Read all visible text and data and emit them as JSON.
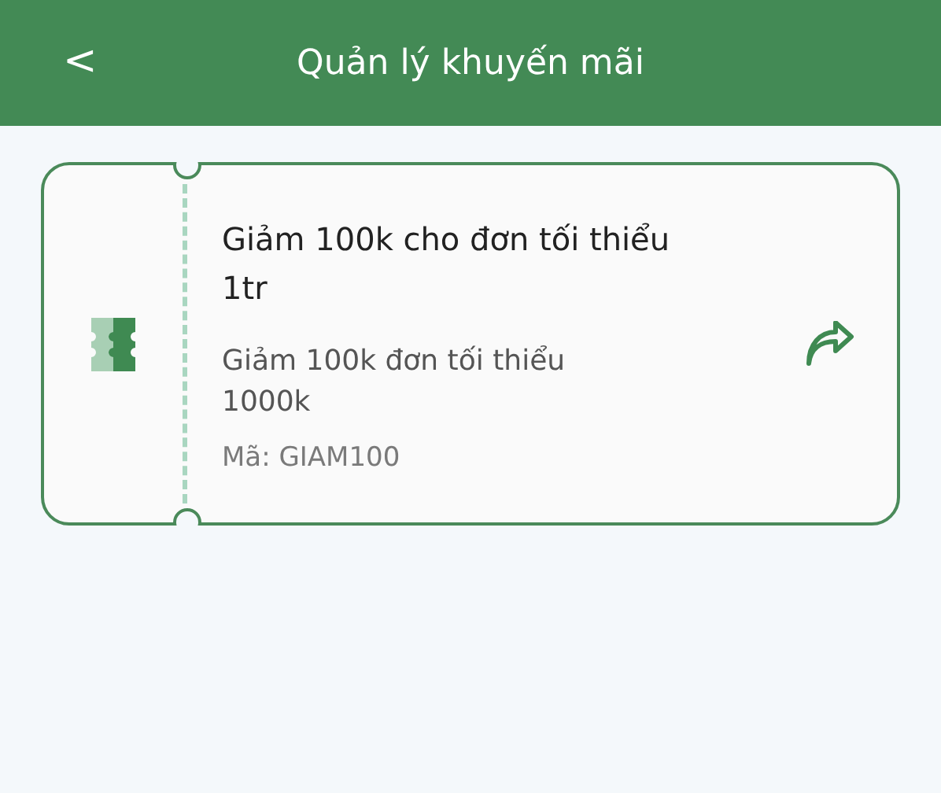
{
  "header": {
    "back": "<",
    "title": "Quản lý khuyến mãi"
  },
  "promotions": [
    {
      "title": "Giảm 100k cho đơn tối thiểu 1tr",
      "description": "Giảm 100k đơn tối thiểu 1000k",
      "code": "Mã: GIAM100"
    }
  ]
}
